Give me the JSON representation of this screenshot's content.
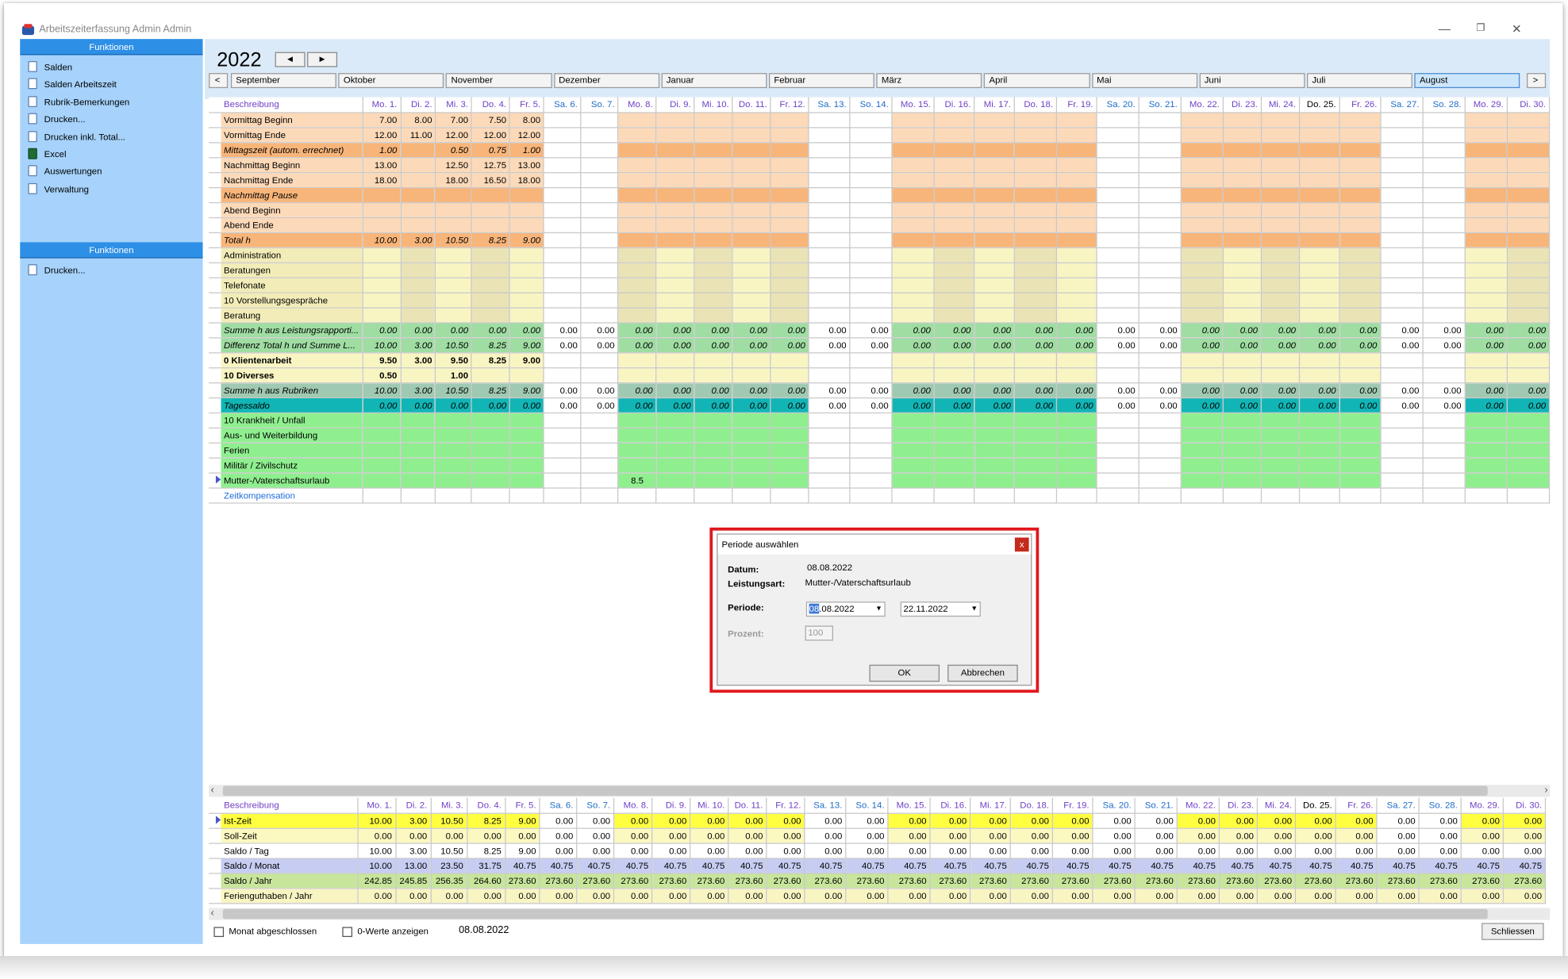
{
  "window": {
    "title": "Arbeitszeiterfassung Admin Admin"
  },
  "sidebar": {
    "header1": "Funktionen",
    "items": [
      {
        "label": "Salden"
      },
      {
        "label": "Salden Arbeitszeit"
      },
      {
        "label": "Rubrik-Bemerkungen"
      },
      {
        "label": "Drucken..."
      },
      {
        "label": "Drucken inkl. Total..."
      },
      {
        "label": "Excel",
        "icon": "excel-icon"
      },
      {
        "label": "Auswertungen"
      },
      {
        "label": "Verwaltung"
      }
    ],
    "header2": "Funktionen",
    "items2": [
      {
        "label": "Drucken..."
      }
    ]
  },
  "year": "2022",
  "nav": {
    "prev": "◄",
    "next": "►",
    "month_prev": "<",
    "month_next": ">"
  },
  "months": [
    "September",
    "Oktober",
    "November",
    "Dezember",
    "Januar",
    "Februar",
    "März",
    "April",
    "Mai",
    "Juni",
    "Juli",
    "August"
  ],
  "selected_month": "August",
  "days": [
    "Mo. 1.",
    "Di. 2.",
    "Mi. 3.",
    "Do. 4.",
    "Fr. 5.",
    "Sa. 6.",
    "So. 7.",
    "Mo. 8.",
    "Di. 9.",
    "Mi. 10.",
    "Do. 11.",
    "Fr. 12.",
    "Sa. 13.",
    "So. 14.",
    "Mo. 15.",
    "Di. 16.",
    "Mi. 17.",
    "Do. 18.",
    "Fr. 19.",
    "Sa. 20.",
    "So. 21.",
    "Mo. 22.",
    "Di. 23.",
    "Mi. 24.",
    "Do. 25.",
    "Fr. 26.",
    "Sa. 27.",
    "So. 28.",
    "Mo. 29.",
    "Di. 30."
  ],
  "top_header_label": "Beschreibung",
  "top_rows": [
    {
      "label": "Vormittag Beginn",
      "type": "time",
      "values": [
        "7.00",
        "8.00",
        "7.00",
        "7.50",
        "8.00"
      ]
    },
    {
      "label": "Vormittag Ende",
      "type": "time",
      "values": [
        "12.00",
        "11.00",
        "12.00",
        "12.00",
        "12.00"
      ]
    },
    {
      "label": "Mittagszeit (autom. errechnet)",
      "type": "calc",
      "values": [
        "1.00",
        "",
        "0.50",
        "0.75",
        "1.00"
      ]
    },
    {
      "label": "Nachmittag Beginn",
      "type": "time",
      "values": [
        "13.00",
        "",
        "12.50",
        "12.75",
        "13.00"
      ]
    },
    {
      "label": "Nachmittag Ende",
      "type": "time",
      "values": [
        "18.00",
        "",
        "18.00",
        "16.50",
        "18.00"
      ]
    },
    {
      "label": "Nachmittag Pause",
      "type": "calc",
      "values": []
    },
    {
      "label": "Abend Beginn",
      "type": "time",
      "values": []
    },
    {
      "label": "Abend Ende",
      "type": "time",
      "values": []
    },
    {
      "label": "Total h",
      "type": "calc",
      "values": [
        "10.00",
        "3.00",
        "10.50",
        "8.25",
        "9.00"
      ]
    },
    {
      "label": "Administration",
      "type": "rub",
      "values": []
    },
    {
      "label": "Beratungen",
      "type": "rub",
      "values": []
    },
    {
      "label": "Telefonate",
      "type": "rub",
      "values": []
    },
    {
      "label": "10 Vorstellungsgespräche",
      "type": "rub",
      "values": []
    },
    {
      "label": "Beratung",
      "type": "rub",
      "values": []
    },
    {
      "label": "Summe h aus Leistungsrapporti...",
      "type": "sum",
      "values": [
        "0.00",
        "0.00",
        "0.00",
        "0.00",
        "0.00"
      ],
      "fill": "0.00"
    },
    {
      "label": "Differenz Total h und Summe L...",
      "type": "sum",
      "values": [
        "10.00",
        "3.00",
        "10.50",
        "8.25",
        "9.00"
      ],
      "fill": "0.00"
    },
    {
      "label": "0 Klientenarbeit",
      "type": "bold",
      "values": [
        "9.50",
        "3.00",
        "9.50",
        "8.25",
        "9.00"
      ]
    },
    {
      "label": "10 Diverses",
      "type": "bold",
      "values": [
        "0.50",
        "",
        "1.00"
      ]
    },
    {
      "label": "Summe h aus Rubriken",
      "type": "sum2",
      "values": [
        "10.00",
        "3.00",
        "10.50",
        "8.25",
        "9.00"
      ],
      "fill": "0.00"
    },
    {
      "label": "Tagessaldo",
      "type": "saldo",
      "values": [
        "0.00",
        "0.00",
        "0.00",
        "0.00",
        "0.00"
      ],
      "fill": "0.00"
    },
    {
      "label": "10 Krankheit / Unfall",
      "type": "abs",
      "values": []
    },
    {
      "label": "Aus- und Weiterbildung",
      "type": "abs",
      "values": []
    },
    {
      "label": "Ferien",
      "type": "abs",
      "values": []
    },
    {
      "label": "Militär / Zivilschutz",
      "type": "abs",
      "values": []
    },
    {
      "label": "Mutter-/Vaterschaftsurlaub",
      "type": "abs",
      "values": [
        "",
        "",
        "",
        "",
        "",
        "",
        "",
        "8.5"
      ],
      "selected": true
    },
    {
      "label": "Zeitkompensation",
      "type": "link",
      "values": []
    }
  ],
  "bottom_header_label": "Beschreibung",
  "bottom_rows": [
    {
      "label": "Ist-Zeit",
      "type": "ist",
      "values": [
        "10.00",
        "3.00",
        "10.50",
        "8.25",
        "9.00"
      ],
      "fill": "0.00",
      "selected": true
    },
    {
      "label": "Soll-Zeit",
      "type": "soll",
      "values": [
        "0.00",
        "0.00",
        "0.00",
        "0.00",
        "0.00"
      ],
      "fill": "0.00"
    },
    {
      "label": "Saldo / Tag",
      "type": "tag",
      "values": [
        "10.00",
        "3.00",
        "10.50",
        "8.25",
        "9.00"
      ],
      "fill": "0.00"
    },
    {
      "label": "Saldo / Monat",
      "type": "monat",
      "values": [
        "10.00",
        "13.00",
        "23.50",
        "31.75",
        "40.75"
      ],
      "fill": "40.75"
    },
    {
      "label": "Saldo / Jahr",
      "type": "jahr",
      "values": [
        "242.85",
        "245.85",
        "256.35",
        "264.60",
        "273.60"
      ],
      "fill": "273.60"
    },
    {
      "label": "Ferienguthaben / Jahr",
      "type": "ferien",
      "values": [
        "0.00",
        "0.00",
        "0.00",
        "0.00",
        "0.00"
      ],
      "fill": "0.00"
    }
  ],
  "footer": {
    "monat_label": "Monat abgeschlossen",
    "nullwerte_label": "0-Werte anzeigen",
    "date": "08.08.2022",
    "close_label": "Schliessen"
  },
  "dialog": {
    "title": "Periode auswählen",
    "close": "x",
    "datum_label": "Datum:",
    "datum_value": "08.08.2022",
    "leistungsart_label": "Leistungsart:",
    "leistungsart_value": "Mutter-/Vaterschaftsurlaub",
    "periode_label": "Periode:",
    "from_highlight": "08",
    "from_rest": ".08.2022",
    "to_value": "22.11.2022",
    "prozent_label": "Prozent:",
    "prozent_value": "100",
    "ok_label": "OK",
    "cancel_label": "Abbrechen"
  },
  "colors": {
    "sidebar": "#a6d2fb",
    "sidebar_header": "#2d8fe6",
    "time": "#fcd9b8",
    "calc": "#f8b57a",
    "rubrik_weekday": "#f8f5c3",
    "rubrik_weekday_alt": "#e5ddb0",
    "sum": "#9fdda2",
    "tagessaldo": "#12b5b5",
    "absence": "#8fef8f",
    "ist": "#ffff40",
    "monat": "#c7cdf2",
    "jahr": "#c7e59b",
    "highlight_frame": "#e0191e"
  }
}
